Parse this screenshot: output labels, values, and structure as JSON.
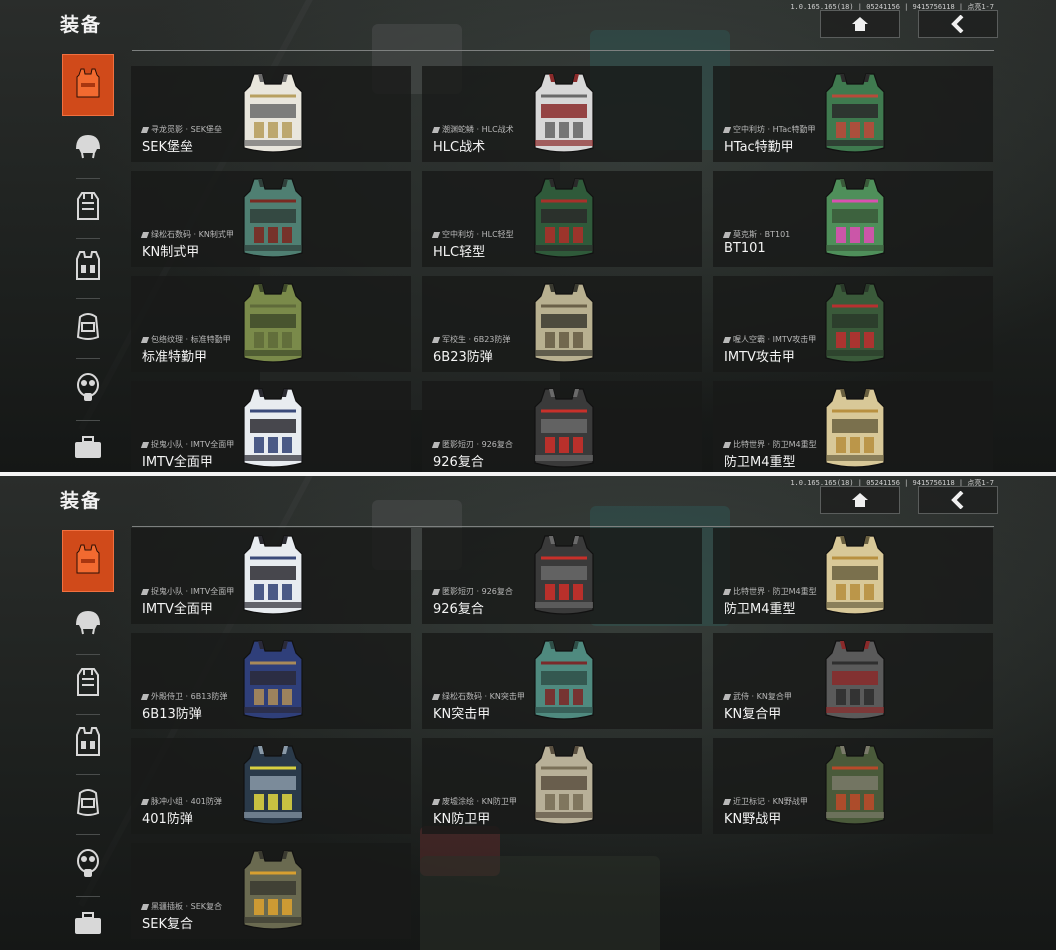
{
  "screens": [
    {
      "title": "装备",
      "version": "1.0.165.165(18) | 05241156 | 9415756118 | 点亮1-7",
      "cards": [
        {
          "sub": "寻龙觅影 · SEK堡垒",
          "name": "SEK堡垒",
          "c1": "#e9e6dc",
          "c2": "#b8a060",
          "c3": "#6a6a6a"
        },
        {
          "sub": "潮渊蛇鳞 · HLC战术",
          "name": "HLC战术",
          "c1": "#d8d8d8",
          "c2": "#6a6a6a",
          "c3": "#8a2a2a"
        },
        {
          "sub": "空中利坊 · HTac特勤甲",
          "name": "HTac特勤甲",
          "c1": "#3f7a4f",
          "c2": "#b84a3a",
          "c3": "#2a2a2a"
        },
        {
          "sub": "绿松石数码 · KN制式甲",
          "name": "KN制式甲",
          "c1": "#4f7f72",
          "c2": "#7a2a22",
          "c3": "#2f3f3a"
        },
        {
          "sub": "空中利坊 · HLC轻型",
          "name": "HLC轻型",
          "c1": "#2f5a3a",
          "c2": "#a8302a",
          "c3": "#2a2a2a"
        },
        {
          "sub": "莫克斯 · BT101",
          "name": "BT101",
          "c1": "#4f8f5a",
          "c2": "#d850b0",
          "c3": "#3a5a3a"
        },
        {
          "sub": "包络纹理 · 标准特勤甲",
          "name": "标准特勤甲",
          "c1": "#7a8a4a",
          "c2": "#5f6a3a",
          "c3": "#3f4a2a"
        },
        {
          "sub": "军校生 · 6B23防弹",
          "name": "6B23防弹",
          "c1": "#b8b090",
          "c2": "#6a6048",
          "c3": "#3a3a30"
        },
        {
          "sub": "喔人空霸 · IMTV攻击甲",
          "name": "IMTV攻击甲",
          "c1": "#3a5a3a",
          "c2": "#b83030",
          "c3": "#2a3a2a"
        },
        {
          "sub": "捉鬼小队 · IMTV全面甲",
          "name": "IMTV全面甲",
          "c1": "#e8ecf0",
          "c2": "#3a4a7a",
          "c3": "#2a2a30"
        },
        {
          "sub": "匿影短刃 · 926复合",
          "name": "926复合",
          "c1": "#3a3a3a",
          "c2": "#c8302a",
          "c3": "#6a6a6a"
        },
        {
          "sub": "比特世界 · 防卫M4重型",
          "name": "防卫M4重型",
          "c1": "#d8c898",
          "c2": "#b89040",
          "c3": "#6a6040"
        }
      ]
    },
    {
      "title": "装备",
      "version": "1.0.165.165(18) | 05241156 | 9415756118 | 点亮1-7",
      "cards": [
        {
          "sub": "捉鬼小队 · IMTV全面甲",
          "name": "IMTV全面甲",
          "c1": "#e8ecf0",
          "c2": "#3a4a7a",
          "c3": "#2a2a30"
        },
        {
          "sub": "匿影短刃 · 926复合",
          "name": "926复合",
          "c1": "#3a3a3a",
          "c2": "#c8302a",
          "c3": "#6a6a6a"
        },
        {
          "sub": "比特世界 · 防卫M4重型",
          "name": "防卫M4重型",
          "c1": "#d8c898",
          "c2": "#b89040",
          "c3": "#6a6040"
        },
        {
          "sub": "外殿侍卫 · 6B13防弹",
          "name": "6B13防弹",
          "c1": "#2f3f7a",
          "c2": "#a88a5a",
          "c3": "#2a2a3a"
        },
        {
          "sub": "绿松石数码 · KN突击甲",
          "name": "KN突击甲",
          "c1": "#4f8a7f",
          "c2": "#7a2a2a",
          "c3": "#2f4f48"
        },
        {
          "sub": "武侍 · KN复合甲",
          "name": "KN复合甲",
          "c1": "#5a5a5a",
          "c2": "#2f2f2f",
          "c3": "#8a2a2a"
        },
        {
          "sub": "脉冲小组 · 401防弹",
          "name": "401防弹",
          "c1": "#2a3a4a",
          "c2": "#d8d040",
          "c3": "#8a9aa8"
        },
        {
          "sub": "废墟涂绘 · KN防卫甲",
          "name": "KN防卫甲",
          "c1": "#b8b098",
          "c2": "#7a7058",
          "c3": "#5a5040"
        },
        {
          "sub": "近卫标记 · KN野战甲",
          "name": "KN野战甲",
          "c1": "#4a5a3a",
          "c2": "#b84a2a",
          "c3": "#7a7a6a"
        },
        {
          "sub": "黑疆插板 · SEK复合",
          "name": "SEK复合",
          "c1": "#6a6a50",
          "c2": "#d8a030",
          "c3": "#3a3a30"
        }
      ]
    }
  ],
  "icons": {
    "home": "home-icon",
    "back": "back-arrow-icon",
    "sidebar": [
      "vest-icon",
      "helmet-icon",
      "backpack-icon",
      "chest-rig-icon",
      "bag-icon",
      "gas-mask-icon",
      "case-icon"
    ]
  },
  "colors": {
    "accent": "#d04a1a"
  }
}
